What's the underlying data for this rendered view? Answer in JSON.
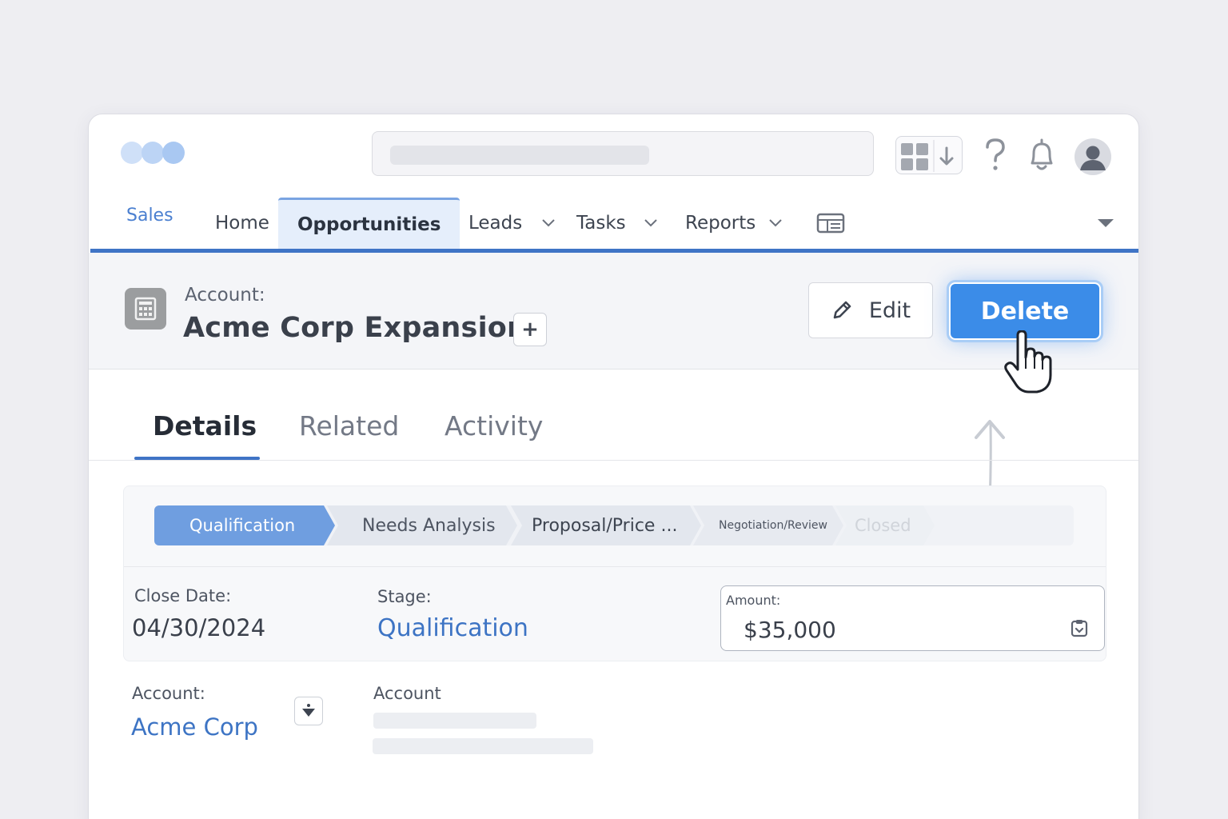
{
  "colors": {
    "accent": "#3f74c6",
    "primary_button": "#3b8ce8",
    "link": "#3d74c4",
    "active_step": "#6f9ee0"
  },
  "nav": {
    "app_name": "Sales",
    "items": [
      {
        "label": "Home",
        "icon": ""
      },
      {
        "label": "Opportunities",
        "icon": "chevron-down-icon",
        "active": true
      },
      {
        "label": "Leads",
        "icon": "chevron-down-icon"
      },
      {
        "label": "Tasks",
        "icon": "chevron-down-icon"
      },
      {
        "label": "Reports",
        "icon": "chevron-down-icon"
      }
    ],
    "extra_icon": "dashboard-icon",
    "more_icon": "caret-down-icon"
  },
  "topbar": {
    "icons": [
      "app-launcher-icon",
      "download-icon",
      "help-icon",
      "bell-icon",
      "avatar-icon"
    ]
  },
  "record": {
    "label": "Account:",
    "title": "Acme Corp Expansion",
    "add_label": "+",
    "edit_label": "Edit",
    "delete_label": "Delete"
  },
  "tabs": [
    "Details",
    "Related",
    "Activity"
  ],
  "path": {
    "steps": [
      {
        "label": "Qualification",
        "state": "active"
      },
      {
        "label": "Needs Analysis",
        "state": "pending"
      },
      {
        "label": "Proposal/Price ...",
        "state": "pending"
      },
      {
        "label": "Negotiation/Review",
        "state": "pending"
      },
      {
        "label": "Closed",
        "state": "faded"
      }
    ]
  },
  "fields": {
    "close_date": {
      "label": "Close Date:",
      "value": "04/30/2024"
    },
    "stage": {
      "label": "Stage:",
      "value": "Qualification"
    },
    "amount": {
      "label": "Amount:",
      "value": "$35,000"
    },
    "account": {
      "label": "Account:",
      "value": "Acme Corp"
    },
    "account2": {
      "label": "Account"
    }
  }
}
